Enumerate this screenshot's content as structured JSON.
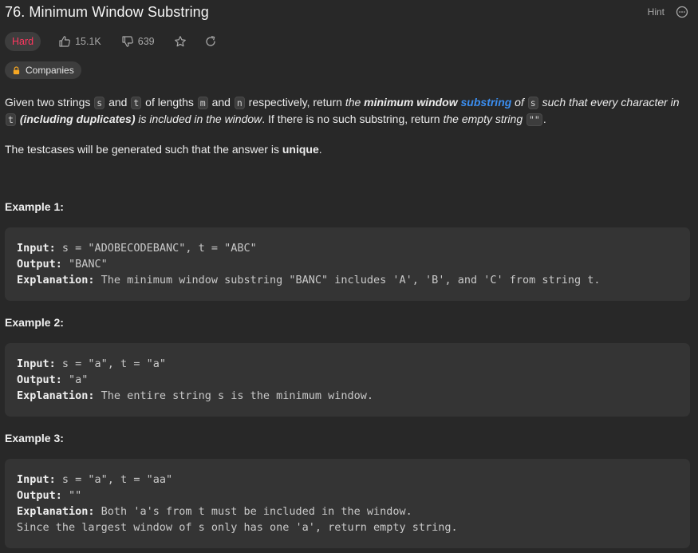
{
  "problem": {
    "title": "76. Minimum Window Substring",
    "hint_label": "Hint",
    "difficulty": "Hard",
    "likes": "15.1K",
    "dislikes": "639",
    "companies_label": "Companies"
  },
  "description": {
    "p1": {
      "t1": "Given two strings ",
      "c_s": "s",
      "t2": " and ",
      "c_t": "t",
      "t3": " of lengths ",
      "c_m": "m",
      "t4": " and ",
      "c_n": "n",
      "t5": " respectively, return ",
      "em1": "the ",
      "em_b1": "minimum window",
      "sp": " ",
      "link": "substring",
      "em2": " of ",
      "c_s2": "s",
      "em3": " such that every character in ",
      "c_t2": "t",
      "sp2": " ",
      "em_b2": "(including duplicates)",
      "em4": " is included in the window",
      "t6": ". If there is no such substring, return ",
      "em5": "the empty string ",
      "c_empty": "\"\"",
      "t7": "."
    },
    "p2": {
      "t1": "The testcases will be generated such that the answer is ",
      "b": "unique",
      "t2": "."
    }
  },
  "examples": [
    {
      "title": "Example 1:",
      "input_label": "Input:",
      "input": " s = \"ADOBECODEBANC\", t = \"ABC\"",
      "output_label": "Output:",
      "output": " \"BANC\"",
      "explanation_label": "Explanation:",
      "explanation": " The minimum window substring \"BANC\" includes 'A', 'B', and 'C' from string t."
    },
    {
      "title": "Example 2:",
      "input_label": "Input:",
      "input": " s = \"a\", t = \"a\"",
      "output_label": "Output:",
      "output": " \"a\"",
      "explanation_label": "Explanation:",
      "explanation": " The entire string s is the minimum window."
    },
    {
      "title": "Example 3:",
      "input_label": "Input:",
      "input": " s = \"a\", t = \"aa\"",
      "output_label": "Output:",
      "output": " \"\"",
      "explanation_label": "Explanation:",
      "explanation": " Both 'a's from t must be included in the window.",
      "explanation_line2": "Since the largest window of s only has one 'a', return empty string."
    }
  ],
  "colors": {
    "background": "#282828",
    "hard": "#ff375f",
    "link": "#3b8ef0",
    "code_bg": "#343434"
  },
  "icons": {
    "more": "more-icon",
    "like": "thumbs-up-icon",
    "dislike": "thumbs-down-icon",
    "star": "star-icon",
    "share": "share-icon",
    "lock": "lock-icon"
  }
}
